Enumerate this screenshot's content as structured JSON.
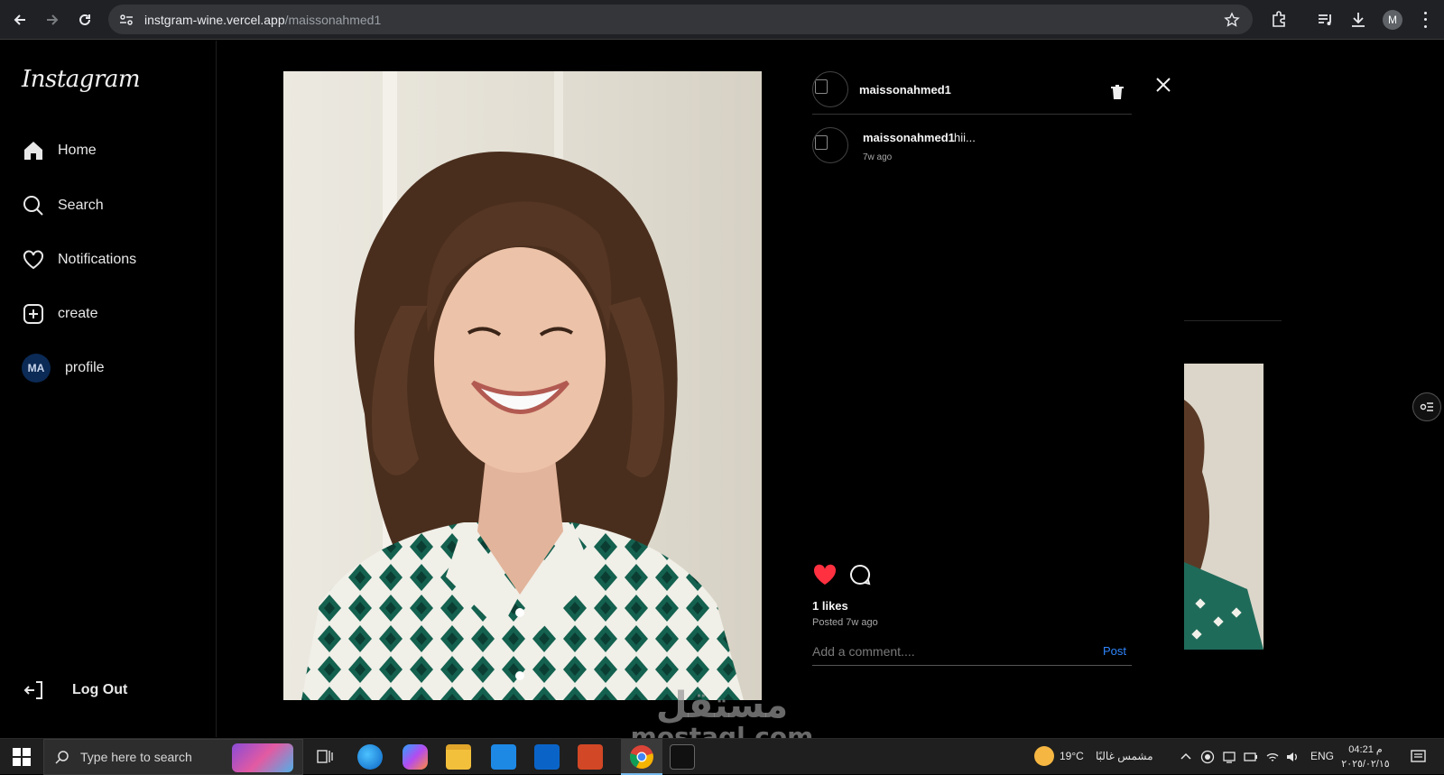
{
  "browser": {
    "host": "instgram-wine.vercel.app",
    "path": "/maissonahmed1",
    "profile_initial": "M"
  },
  "sidebar": {
    "logo": "Instagram",
    "items": [
      {
        "label": "Home",
        "icon": "home-icon"
      },
      {
        "label": "Search",
        "icon": "search-icon"
      },
      {
        "label": "Notifications",
        "icon": "heart-icon"
      },
      {
        "label": "create",
        "icon": "plus-square-icon"
      },
      {
        "label": "profile",
        "icon": "avatar",
        "avatar_text": "MA"
      }
    ],
    "logout_label": "Log Out"
  },
  "post": {
    "username": "maissonahmed1",
    "comments": [
      {
        "user": "maissonahmed1",
        "text": "hii...",
        "time": "7w ago"
      }
    ],
    "likes_text": "1 likes",
    "posted_text": "Posted 7w ago",
    "comment_placeholder": "Add a comment....",
    "post_button": "Post",
    "liked": true
  },
  "watermark": {
    "arabic": "مستقل",
    "latin": "mostaql.com"
  },
  "taskbar": {
    "search_placeholder": "Type here to search",
    "weather_temp": "19°C",
    "weather_text": "مشمس غالبًا",
    "language": "ENG",
    "time": "04:21 م",
    "date": "٢٠٢٥/٠٢/١٥"
  },
  "colors": {
    "accent_link": "#2f87ff",
    "like_red": "#ff3040",
    "background": "#000000"
  }
}
